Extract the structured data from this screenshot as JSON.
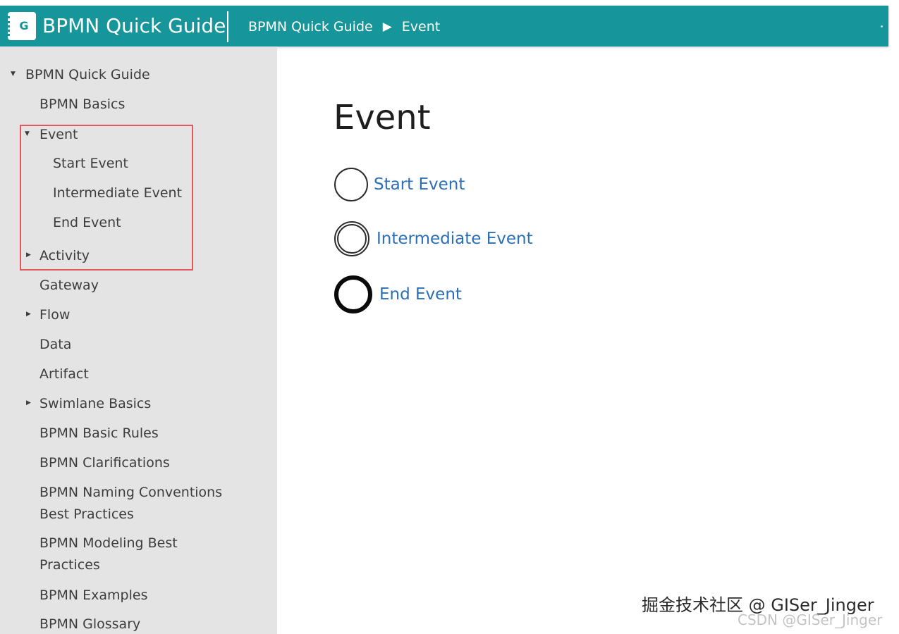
{
  "app": {
    "logo_letter": "G",
    "title": "BPMN Quick Guide",
    "breadcrumb": [
      "BPMN Quick Guide",
      "Event"
    ],
    "breadcrumb_separator": "▶"
  },
  "sidebar": {
    "root": {
      "label": "BPMN Quick Guide",
      "expanded": true
    },
    "items": [
      {
        "label": "BPMN Basics"
      },
      {
        "label": "Event",
        "expanded": true,
        "children": [
          "Start Event",
          "Intermediate Event",
          "End Event"
        ]
      },
      {
        "label": "Activity",
        "expandable": true
      },
      {
        "label": "Gateway"
      },
      {
        "label": "Flow",
        "expandable": true
      },
      {
        "label": "Data"
      },
      {
        "label": "Artifact"
      },
      {
        "label": "Swimlane Basics",
        "expandable": true
      },
      {
        "label": "BPMN Basic Rules"
      },
      {
        "label": "BPMN Clarifications"
      },
      {
        "label": "BPMN Naming Conventions Best Practices"
      },
      {
        "label": "BPMN Modeling Best Practices"
      },
      {
        "label": "BPMN Examples"
      },
      {
        "label": "BPMN Glossary"
      }
    ],
    "highlight_color": "#e2575b"
  },
  "content": {
    "title": "Event",
    "events": [
      {
        "label": "Start Event",
        "icon": "start-event-circle-icon"
      },
      {
        "label": "Intermediate Event",
        "icon": "intermediate-event-double-circle-icon"
      },
      {
        "label": "End Event",
        "icon": "end-event-thick-circle-icon"
      }
    ],
    "link_color": "#2a6fb8"
  },
  "watermark": {
    "line1": "掘金技术社区 @ GISer_Jinger",
    "line2": "CSDN @GISer_Jinger"
  },
  "colors": {
    "header": "#16969a",
    "sidebar": "#e4e4e4"
  }
}
